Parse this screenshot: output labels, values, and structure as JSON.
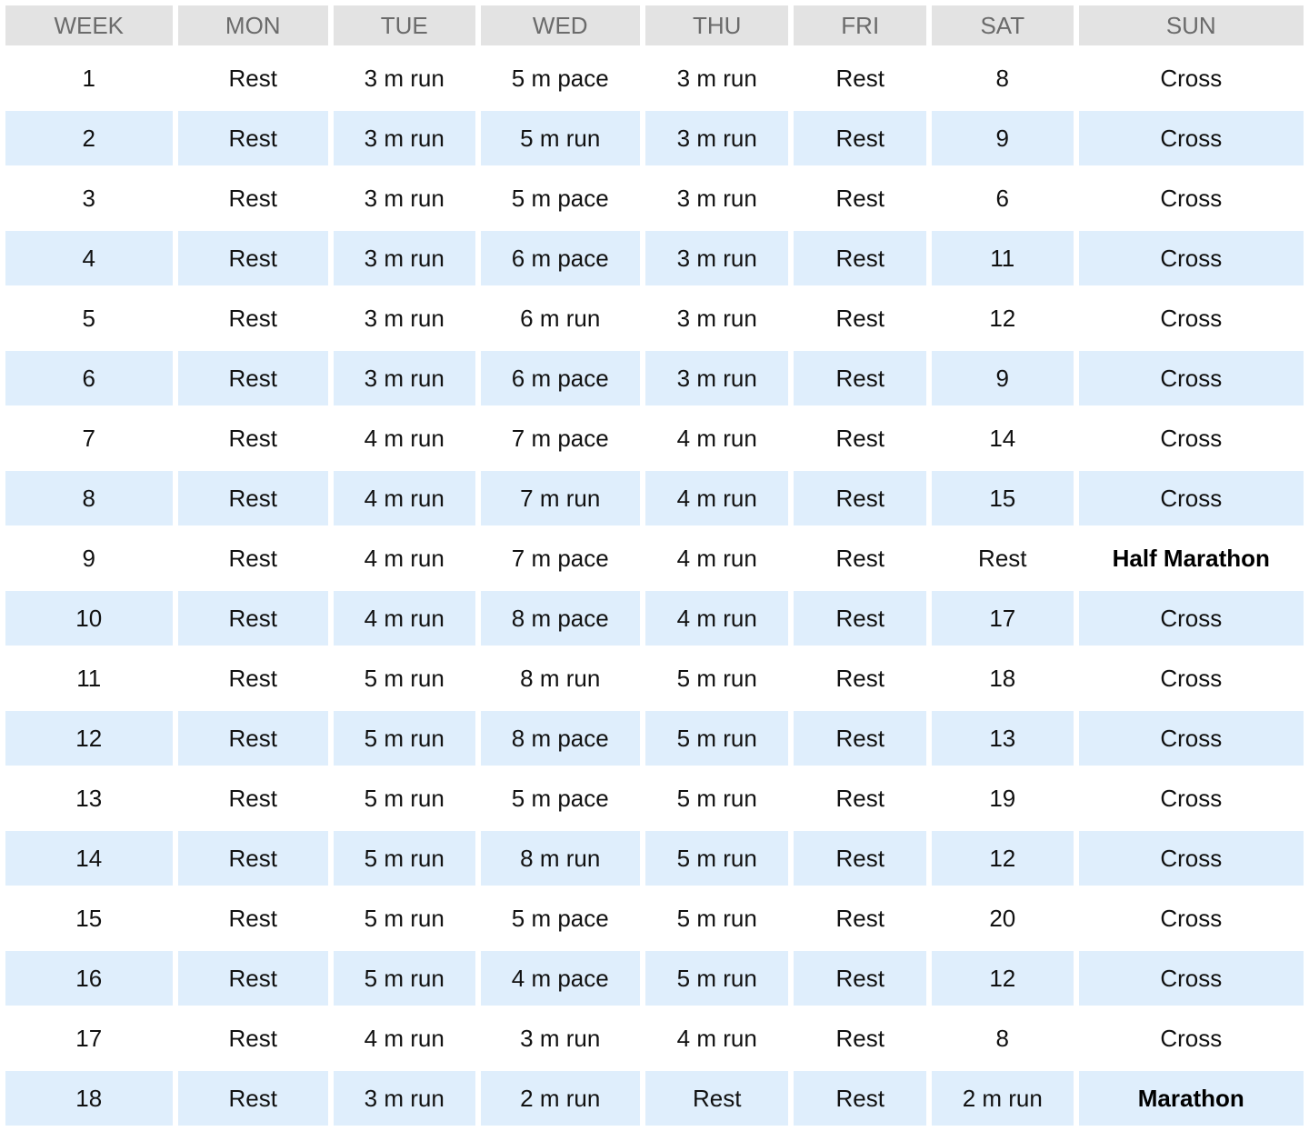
{
  "table": {
    "headers": [
      "WEEK",
      "MON",
      "TUE",
      "WED",
      "THU",
      "FRI",
      "SAT",
      "SUN"
    ],
    "rows": [
      {
        "cells": [
          "1",
          "Rest",
          "3 m run",
          "5 m pace",
          "3 m run",
          "Rest",
          "8",
          "Cross"
        ]
      },
      {
        "cells": [
          "2",
          "Rest",
          "3 m run",
          "5 m run",
          "3 m run",
          "Rest",
          "9",
          "Cross"
        ]
      },
      {
        "cells": [
          "3",
          "Rest",
          "3 m run",
          "5 m pace",
          "3 m run",
          "Rest",
          "6",
          "Cross"
        ]
      },
      {
        "cells": [
          "4",
          "Rest",
          "3 m run",
          "6 m pace",
          "3 m run",
          "Rest",
          "11",
          "Cross"
        ]
      },
      {
        "cells": [
          "5",
          "Rest",
          "3 m run",
          "6 m run",
          "3 m run",
          "Rest",
          "12",
          "Cross"
        ]
      },
      {
        "cells": [
          "6",
          "Rest",
          "3 m run",
          "6 m pace",
          "3 m run",
          "Rest",
          "9",
          "Cross"
        ]
      },
      {
        "cells": [
          "7",
          "Rest",
          "4 m run",
          "7 m pace",
          "4 m run",
          "Rest",
          "14",
          "Cross"
        ]
      },
      {
        "cells": [
          "8",
          "Rest",
          "4 m run",
          "7 m run",
          "4 m run",
          "Rest",
          "15",
          "Cross"
        ]
      },
      {
        "cells": [
          "9",
          "Rest",
          "4 m run",
          "7 m pace",
          "4 m run",
          "Rest",
          "Rest",
          "Half Marathon"
        ],
        "race": true
      },
      {
        "cells": [
          "10",
          "Rest",
          "4 m run",
          "8 m pace",
          "4 m run",
          "Rest",
          "17",
          "Cross"
        ]
      },
      {
        "cells": [
          "11",
          "Rest",
          "5 m run",
          "8 m run",
          "5 m run",
          "Rest",
          "18",
          "Cross"
        ]
      },
      {
        "cells": [
          "12",
          "Rest",
          "5 m run",
          "8 m pace",
          "5 m run",
          "Rest",
          "13",
          "Cross"
        ]
      },
      {
        "cells": [
          "13",
          "Rest",
          "5 m run",
          "5 m pace",
          "5 m run",
          "Rest",
          "19",
          "Cross"
        ]
      },
      {
        "cells": [
          "14",
          "Rest",
          "5 m run",
          "8 m run",
          "5 m run",
          "Rest",
          "12",
          "Cross"
        ]
      },
      {
        "cells": [
          "15",
          "Rest",
          "5 m run",
          "5 m pace",
          "5 m run",
          "Rest",
          "20",
          "Cross"
        ]
      },
      {
        "cells": [
          "16",
          "Rest",
          "5 m run",
          "4 m pace",
          "5 m run",
          "Rest",
          "12",
          "Cross"
        ]
      },
      {
        "cells": [
          "17",
          "Rest",
          "4 m run",
          "3 m run",
          "4 m run",
          "Rest",
          "8",
          "Cross"
        ]
      },
      {
        "cells": [
          "18",
          "Rest",
          "3 m run",
          "2 m run",
          "Rest",
          "Rest",
          "2 m run",
          "Marathon"
        ],
        "race": true
      }
    ]
  },
  "colors": {
    "header_bg": "#e3e3e3",
    "header_text": "#6b6b6b",
    "alt_row_bg": "#dfeefc",
    "body_text": "#111111"
  }
}
